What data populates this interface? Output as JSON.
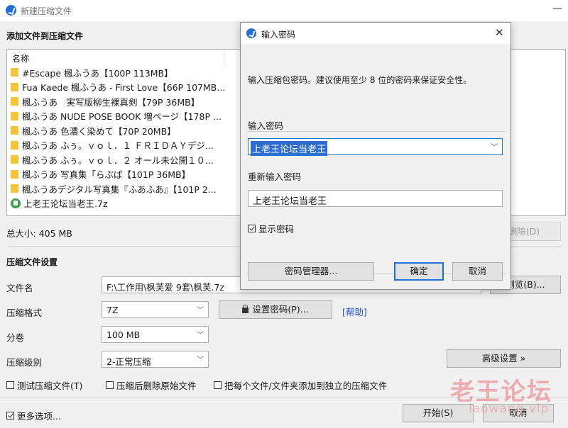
{
  "window": {
    "title": "新建压缩文件",
    "minimize_glyph": "—"
  },
  "files_section": {
    "title": "添加文件到压缩文件",
    "column_header": "名称",
    "items": [
      {
        "name": "#Escape 楓ふうあ【100P 113MB】",
        "icon": "folder-icon"
      },
      {
        "name": "Fua Kaede 楓ふうあ - First Love【66P 107MB...",
        "icon": "folder-icon"
      },
      {
        "name": "楓ふうあ　実写版柳生裸真剣【79P 36MB】",
        "icon": "folder-icon"
      },
      {
        "name": "楓ふうあ NUDE POSE BOOK 増ページ【178P ...",
        "icon": "folder-icon"
      },
      {
        "name": "楓ふうあ 色濃く染めて【70P 20MB】",
        "icon": "folder-icon"
      },
      {
        "name": "楓ふうあ ふぅ。ｖｏｌ．１ ＦＲＩＤＡＹデジ...",
        "icon": "folder-icon"
      },
      {
        "name": "楓ふうあ ふぅ。ｖｏｌ．２ オール未公開１０...",
        "icon": "folder-icon"
      },
      {
        "name": "楓ふうあ 写真集「らぶぱ【101P 36MB】",
        "icon": "folder-icon"
      },
      {
        "name": "楓ふうあデジタル写真集『ふあふあ』【101P 2...",
        "icon": "folder-icon"
      },
      {
        "name": "上老王论坛当老王.7z",
        "icon": "archive-icon"
      }
    ],
    "total_size": "总大小: 405 MB",
    "delete_button": "删除(D)"
  },
  "settings": {
    "title": "压缩文件设置",
    "filename_label": "文件名",
    "filename_value": "F:\\工作用\\枫芙爱 9套\\枫芙.7z",
    "browse_button": "浏览(B)...",
    "format_label": "压缩格式",
    "format_value": "7Z",
    "set_password_button": "设置密码(P)...",
    "help_link": "[帮助]",
    "volume_label": "分卷",
    "volume_value": "100 MB",
    "level_label": "压缩级别",
    "level_value": "2-正常压缩",
    "advanced_button": "高级设置 »",
    "test_archive": "测试压缩文件(T)",
    "delete_after": "压缩后删除原始文件",
    "separate_archives": "把每个文件/文件夹添加到独立的压缩文件",
    "more_options": "更多选项...",
    "start_button": "开始(S)",
    "cancel_button": "取消"
  },
  "watermark": {
    "main": "老王论坛",
    "sub": "laowang.vip"
  },
  "password_dialog": {
    "title": "输入密码",
    "close_glyph": "✕",
    "instruction": "输入压缩包密码。建议使用至少 8 位的密码来保证安全性。",
    "password_label": "输入密码",
    "password_value": "上老王论坛当老王",
    "reenter_label": "重新输入密码",
    "reenter_value": "上老王论坛当老王",
    "show_password": "显示密码",
    "show_password_checked": true,
    "manager_button": "密码管理器...",
    "ok_button": "确定",
    "cancel_button": "取消"
  }
}
